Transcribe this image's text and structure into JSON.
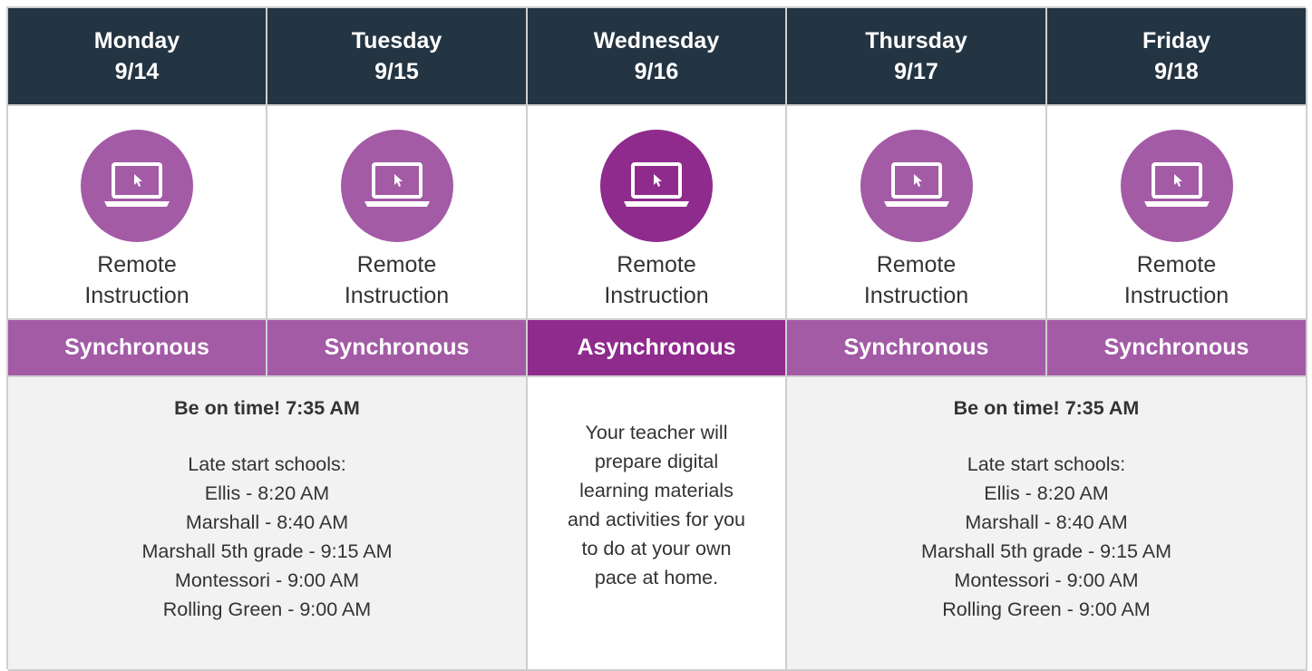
{
  "days": [
    {
      "name": "Monday",
      "date": "9/14",
      "mode": "Remote Instruction",
      "mode_line1": "Remote",
      "mode_line2": "Instruction",
      "type": "Synchronous"
    },
    {
      "name": "Tuesday",
      "date": "9/15",
      "mode": "Remote Instruction",
      "mode_line1": "Remote",
      "mode_line2": "Instruction",
      "type": "Synchronous"
    },
    {
      "name": "Wednesday",
      "date": "9/16",
      "mode": "Remote Instruction",
      "mode_line1": "Remote",
      "mode_line2": "Instruction",
      "type": "Asynchronous"
    },
    {
      "name": "Thursday",
      "date": "9/17",
      "mode": "Remote Instruction",
      "mode_line1": "Remote",
      "mode_line2": "Instruction",
      "type": "Synchronous"
    },
    {
      "name": "Friday",
      "date": "9/18",
      "mode": "Remote Instruction",
      "mode_line1": "Remote",
      "mode_line2": "Instruction",
      "type": "Synchronous"
    }
  ],
  "sync_details": {
    "ontime": "Be on time! 7:35 AM",
    "late_heading": "Late start schools:",
    "schools": [
      "Ellis - 8:20 AM",
      "Marshall - 8:40 AM",
      "Marshall 5th grade - 9:15 AM",
      "Montessori - 9:00 AM",
      "Rolling Green - 9:00 AM"
    ]
  },
  "async_details": {
    "lines": [
      "Your teacher will",
      "prepare digital",
      "learning materials",
      "and activities for you",
      "to do at your own",
      "pace at home."
    ]
  },
  "colors": {
    "header_bg": "#233442",
    "sync_purple": "#a35ba6",
    "async_purple": "#8e2b8d",
    "detail_bg": "#f2f2f2"
  },
  "icon": "laptop-cursor-icon"
}
